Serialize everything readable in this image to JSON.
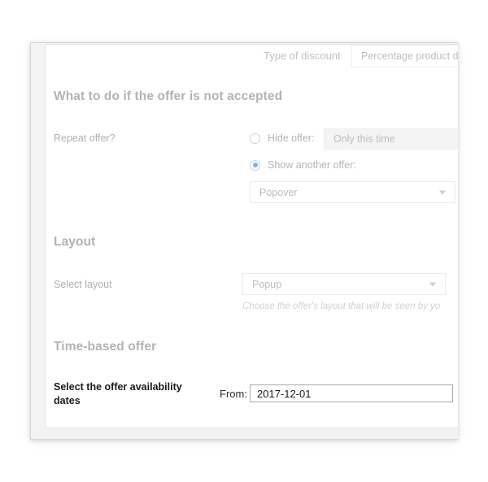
{
  "card": {
    "top_row": {
      "label": "Type of discount",
      "select_value": "Percentage product d",
      "chevron_icon": "chevron-down-icon"
    },
    "sections": [
      {
        "id": "not-accepted",
        "heading": "What to do if the offer is not accepted",
        "repeat_label": "Repeat offer?",
        "options": [
          {
            "id": "hide-offer",
            "label": "Hide offer:",
            "checked": false,
            "select_value": "Only this time",
            "disabled": true
          },
          {
            "id": "show-another-offer",
            "label": "Show another offer:",
            "checked": true
          }
        ],
        "another_offer_select": {
          "value": "Popover",
          "chevron_icon": "chevron-down-icon"
        }
      },
      {
        "id": "layout",
        "heading": "Layout",
        "field_label": "Select layout",
        "select_value": "Popup",
        "chevron_icon": "chevron-down-icon",
        "hint": "Choose the offer's layout that will be seen by yo"
      },
      {
        "id": "time-based",
        "heading": "Time-based offer",
        "field_label": "Select the offer availability dates",
        "from_label": "From:",
        "from_value": "2017-12-01"
      }
    ]
  },
  "colors": {
    "page_background": "#ffffff",
    "card_frame": "#f3f3f3",
    "card_inner": "#ffffff",
    "heading_text": "#b3b3b3",
    "muted_text": "#b0b0b0",
    "strong_text": "#1a1a1a",
    "radio_accent": "#7fb2dd",
    "input_border": "#ebebeb",
    "active_input_border": "#a9a9a9"
  }
}
